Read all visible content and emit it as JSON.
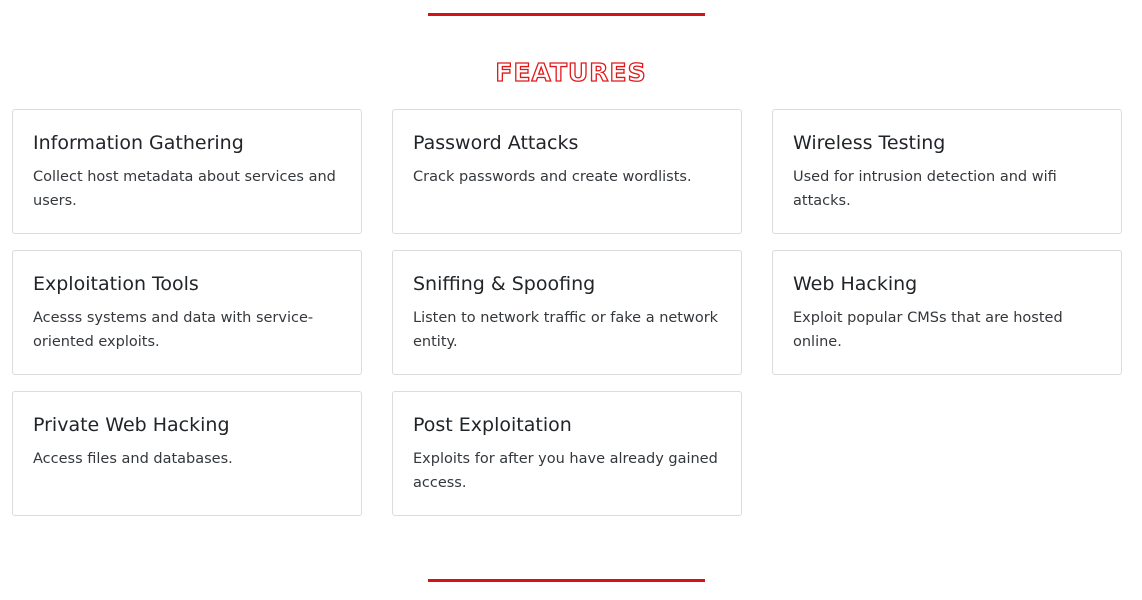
{
  "section": {
    "title": "FEATURES",
    "accent_color": "#d41414"
  },
  "features": [
    {
      "title": "Information Gathering",
      "description": "Collect host metadata about services and users."
    },
    {
      "title": "Password Attacks",
      "description": "Crack passwords and create wordlists."
    },
    {
      "title": "Wireless Testing",
      "description": "Used for intrusion detection and wifi attacks."
    },
    {
      "title": "Exploitation Tools",
      "description": "Acesss systems and data with service-oriented exploits."
    },
    {
      "title": "Sniffing & Spoofing",
      "description": "Listen to network traffic or fake a network entity."
    },
    {
      "title": "Web Hacking",
      "description": "Exploit popular CMSs that are hosted online."
    },
    {
      "title": "Private Web Hacking",
      "description": "Access files and databases."
    },
    {
      "title": "Post Exploitation",
      "description": "Exploits for after you have already gained access."
    }
  ]
}
